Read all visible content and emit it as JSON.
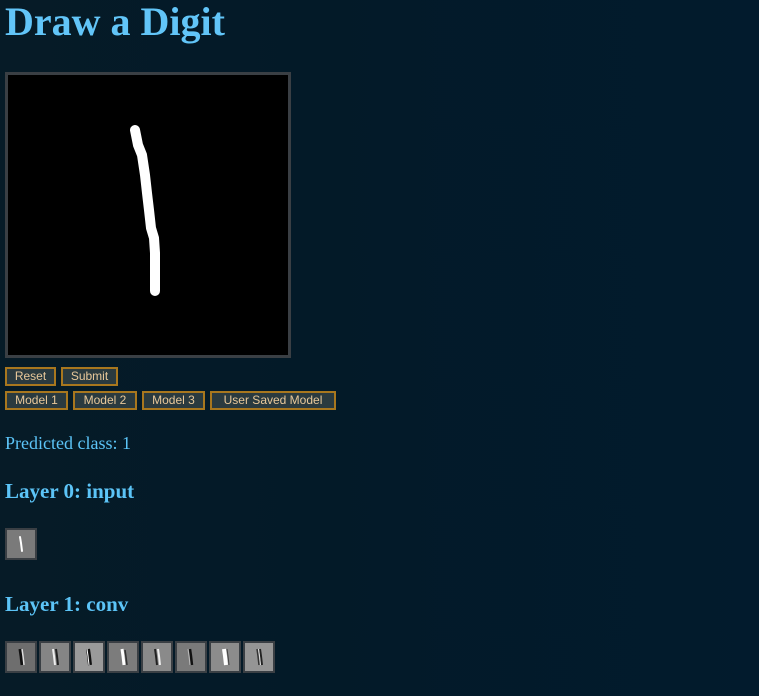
{
  "header": {
    "title": "Draw a Digit"
  },
  "controls": {
    "reset_label": "Reset",
    "submit_label": "Submit"
  },
  "models": [
    "Model 1",
    "Model 2",
    "Model 3",
    "User Saved Model"
  ],
  "prediction": {
    "text": "Predicted class: 1"
  },
  "layers": [
    {
      "title": "Layer 0: input",
      "feature_maps": 1
    },
    {
      "title": "Layer 1: conv",
      "feature_maps": 8
    }
  ],
  "colors": {
    "background": "#031a28",
    "heading": "#62c5f8",
    "button_border": "#a8771e",
    "button_text": "#e8c89a",
    "canvas": "#000000",
    "stroke": "#ffffff"
  }
}
